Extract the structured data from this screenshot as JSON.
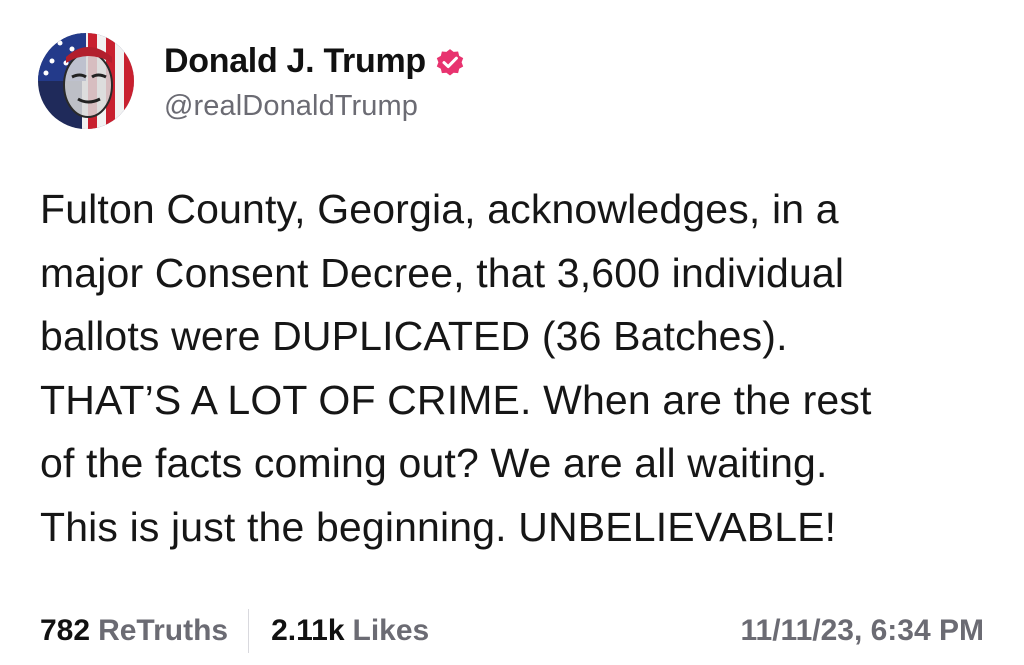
{
  "author": {
    "display_name": "Donald J. Trump",
    "handle": "@realDonaldTrump",
    "verified": true,
    "verified_color": "#e8336f",
    "avatar_icon": "flag-portrait-avatar"
  },
  "post": {
    "lines": [
      "Fulton County, Georgia, acknowledges, in a",
      "major Consent Decree, that 3,600 individual",
      "ballots were DUPLICATED (36 Batches).",
      "THAT’S A LOT OF CRIME. When are the rest",
      "of the facts coming out? We are all waiting.",
      "This is just the beginning. UNBELIEVABLE!"
    ]
  },
  "stats": {
    "retruths_count": "782",
    "retruths_label": "ReTruths",
    "likes_count": "2.11k",
    "likes_label": "Likes",
    "timestamp": "11/11/23, 6:34 PM"
  }
}
